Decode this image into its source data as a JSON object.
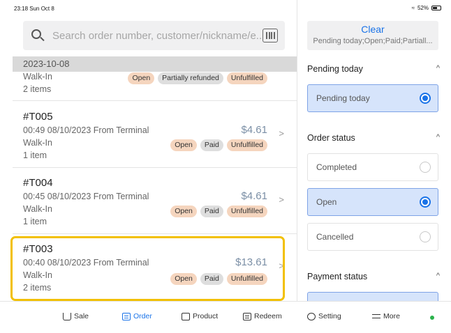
{
  "status_bar": {
    "time": "23:18  Sun Oct 8",
    "battery": "52%"
  },
  "search": {
    "placeholder": "Search order number, customer/nickname/e..."
  },
  "list": {
    "date_header": "2023-10-08",
    "partial_order": {
      "customer": "Walk-In",
      "items": "2 items",
      "badges": [
        "Open",
        "Partially refunded",
        "Unfulfilled"
      ]
    },
    "orders": [
      {
        "number": "#T005",
        "meta": "00:49 08/10/2023 From Terminal",
        "customer": "Walk-In",
        "items": "1 item",
        "amount": "$4.61",
        "badges": [
          "Open",
          "Paid",
          "Unfulfilled"
        ]
      },
      {
        "number": "#T004",
        "meta": "00:45 08/10/2023 From Terminal",
        "customer": "Walk-In",
        "items": "1 item",
        "amount": "$4.61",
        "badges": [
          "Open",
          "Paid",
          "Unfulfilled"
        ]
      },
      {
        "number": "#T003",
        "meta": "00:40 08/10/2023 From Terminal",
        "customer": "Walk-In",
        "items": "2 items",
        "amount": "$13.61",
        "badges": [
          "Open",
          "Paid",
          "Unfulfilled"
        ]
      }
    ]
  },
  "filters": {
    "clear_label": "Clear",
    "summary": "Pending today;Open;Paid;Partiall...",
    "pending": {
      "title": "Pending today",
      "options": [
        {
          "label": "Pending today",
          "selected": true
        }
      ]
    },
    "order_status": {
      "title": "Order status",
      "options": [
        {
          "label": "Completed",
          "selected": false
        },
        {
          "label": "Open",
          "selected": true
        },
        {
          "label": "Cancelled",
          "selected": false
        }
      ]
    },
    "payment_status": {
      "title": "Payment status"
    }
  },
  "nav": {
    "sale": "Sale",
    "order": "Order",
    "product": "Product",
    "redeem": "Redeem",
    "setting": "Setting",
    "more": "More"
  },
  "colors": {
    "accent": "#1a73e8",
    "highlight": "#f2c000",
    "selected_bg": "#d6e4fb",
    "online": "#2bb24c"
  }
}
